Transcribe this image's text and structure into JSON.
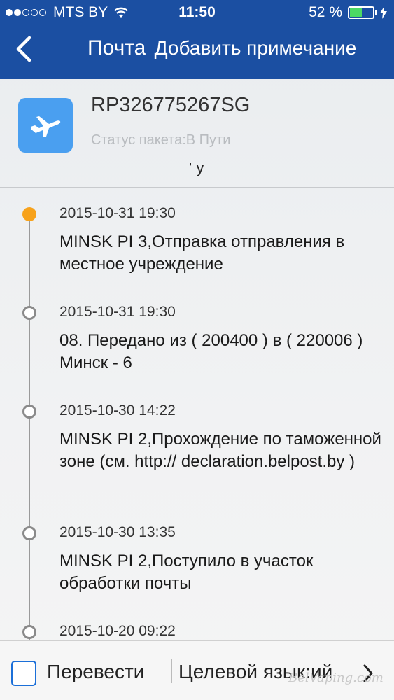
{
  "status_bar": {
    "carrier": "MTS BY",
    "time": "11:50",
    "battery_percent": "52 %",
    "signal_bars": 2,
    "battery_level": 0.52
  },
  "nav": {
    "title": "Почта",
    "subtitle": "Добавить примечание"
  },
  "package": {
    "number": "RP326775267SG",
    "status": "Статус пакета:В Пути",
    "clipped_text": "' у"
  },
  "events": [
    {
      "date": "2015-10-31 19:30",
      "description": "MINSK PI 3,Отправка отправления в местное учреждение",
      "active": true
    },
    {
      "date": "2015-10-31 19:30",
      "description": "08. Передано из ( 200400 ) в ( 220006 ) Минск - 6",
      "active": false
    },
    {
      "date": "2015-10-30 14:22",
      "description": "MINSK PI 2,Прохождение по таможенной зоне (см. http:// declaration.belpost.by )",
      "active": false
    },
    {
      "date": "2015-10-30 13:35",
      "description": "MINSK PI 2,Поступило в участок обработки почты",
      "active": false
    },
    {
      "date": "2015-10-20 09:22",
      "description": "",
      "active": false
    }
  ],
  "bottom_bar": {
    "translate_label": "Перевести",
    "target_language_label": "Целевой язык:ий",
    "checkbox_checked": false
  },
  "watermark": "BelVaping.com",
  "colors": {
    "nav_blue": "#1b4fa2",
    "icon_blue": "#4a9ff0",
    "active_orange": "#f7a21b",
    "battery_green": "#4cd964"
  },
  "icons": {
    "back": "chevron-left-icon",
    "package": "airplane-icon",
    "wifi": "wifi-icon",
    "battery": "battery-icon",
    "charging": "bolt-icon",
    "next": "chevron-right-icon"
  }
}
